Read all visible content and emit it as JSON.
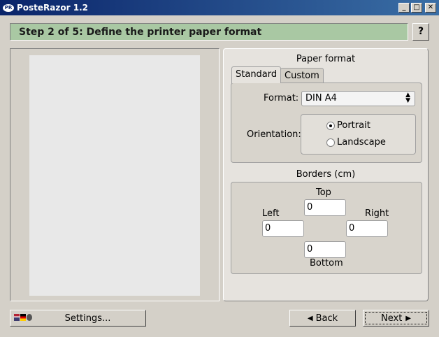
{
  "window": {
    "title": "PosteRazor 1.2",
    "icon_text": "PR",
    "minimize_glyph": "_",
    "maximize_glyph": "□",
    "close_glyph": "✕"
  },
  "step": {
    "title": "Step 2 of 5: Define the printer paper format",
    "help_label": "?"
  },
  "paper_format": {
    "title": "Paper format",
    "tabs": [
      {
        "label": "Standard",
        "active": true
      },
      {
        "label": "Custom",
        "active": false
      }
    ],
    "format_label": "Format:",
    "format_value": "DIN A4",
    "orientation_label": "Orientation:",
    "orientation_options": [
      {
        "label": "Portrait",
        "checked": true
      },
      {
        "label": "Landscape",
        "checked": false
      }
    ]
  },
  "borders": {
    "title": "Borders (cm)",
    "top_label": "Top",
    "top_value": "0",
    "left_label": "Left",
    "left_value": "0",
    "right_label": "Right",
    "right_value": "0",
    "bottom_label": "Bottom",
    "bottom_value": "0"
  },
  "buttons": {
    "settings_label": "Settings...",
    "back_label": "Back",
    "back_icon": "◀",
    "next_label": "Next",
    "next_icon": "▶"
  }
}
